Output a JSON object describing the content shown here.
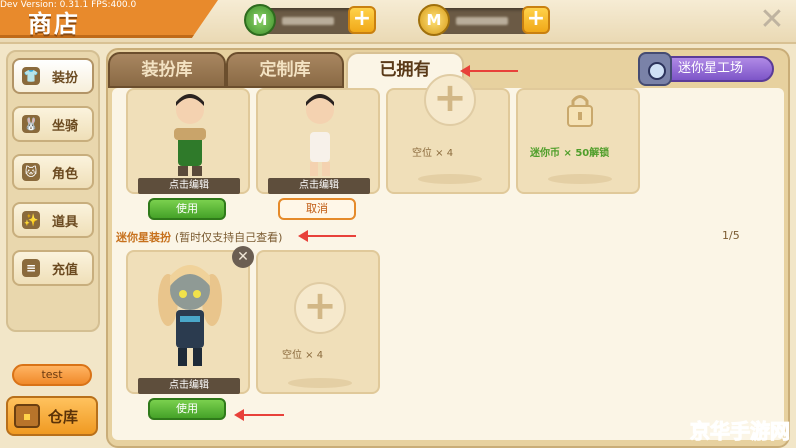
{
  "devinfo": "Dev Version: 0.31.1  FPS:400.0",
  "title": "商店",
  "header": {
    "plus": "+",
    "close": "✕",
    "coin_green": "M",
    "coin_gold": "M"
  },
  "sidebar": {
    "items": [
      {
        "label": "装扮",
        "icon": "shirt-icon",
        "glyph": "👕"
      },
      {
        "label": "坐骑",
        "icon": "mount-icon",
        "glyph": "🐰"
      },
      {
        "label": "角色",
        "icon": "character-icon",
        "glyph": "🐱"
      },
      {
        "label": "道具",
        "icon": "item-icon",
        "glyph": "✨"
      },
      {
        "label": "充值",
        "icon": "recharge-icon",
        "glyph": "≡"
      }
    ],
    "test_label": "test",
    "warehouse_label": "仓库"
  },
  "tabs": [
    {
      "label": "装扮库"
    },
    {
      "label": "定制库"
    },
    {
      "label": "已拥有"
    }
  ],
  "workshop_label": "迷你星工场",
  "grid": {
    "edit_label": "点击编辑",
    "use_label": "使用",
    "cancel_label": "取消",
    "slot_label": "空位 × 4",
    "unlock_label": "迷你币 × 50解锁",
    "plus_glyph": "+"
  },
  "section": {
    "title": "迷你星装扮",
    "subtitle": "(暂时仅支持自己查看)",
    "page": "1/5"
  },
  "remove_glyph": "✕",
  "watermark": "京华手游网",
  "colors": {
    "accent": "#e88a2c",
    "use_green": "#45a228",
    "arrow_red": "#e8413a",
    "workshop_purple": "#7d55c8"
  }
}
